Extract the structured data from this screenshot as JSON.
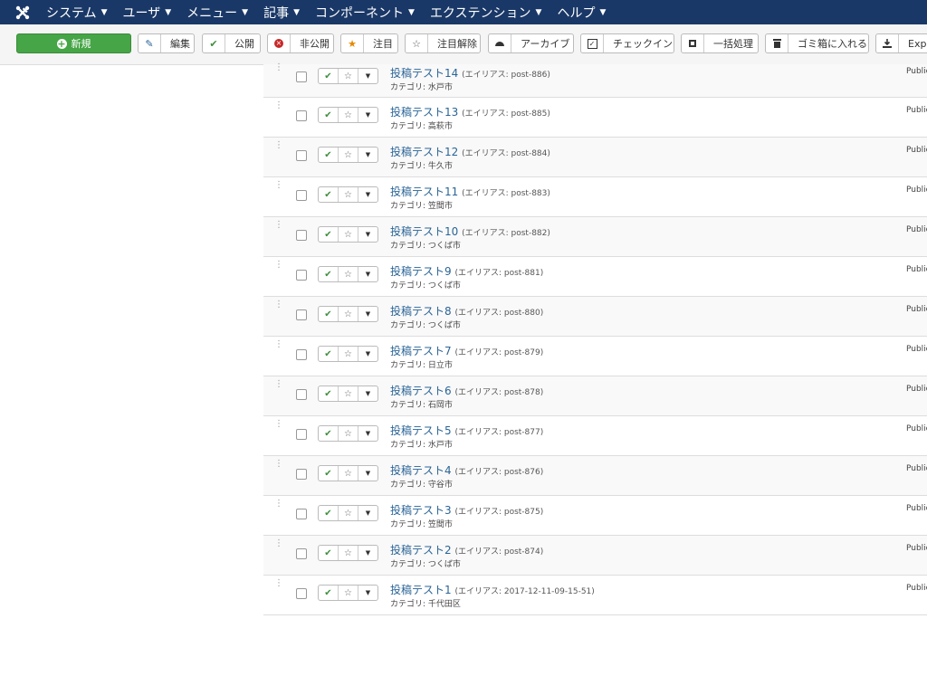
{
  "nav": {
    "items": [
      {
        "label": "システム"
      },
      {
        "label": "ユーザ"
      },
      {
        "label": "メニュー"
      },
      {
        "label": "記事"
      },
      {
        "label": "コンポーネント"
      },
      {
        "label": "エクステンション"
      },
      {
        "label": "ヘルプ"
      }
    ]
  },
  "toolbar": {
    "new_label": "新規",
    "edit_label": "編集",
    "publish_label": "公開",
    "unpublish_label": "非公開",
    "feature_label": "注目",
    "unfeature_label": "注目解除",
    "archive_label": "アーカイブ",
    "checkin_label": "チェックイン",
    "batch_label": "一括処理",
    "trash_label": "ゴミ箱に入れる",
    "export_label": "Expo"
  },
  "articles": {
    "alias_prefix": "(エイリアス: ",
    "alias_suffix": ")",
    "category_prefix": "カテゴリ: ",
    "rows": [
      {
        "title": "投稿テスト14",
        "alias": "post-886",
        "category": "水戸市",
        "status": "Public"
      },
      {
        "title": "投稿テスト13",
        "alias": "post-885",
        "category": "高萩市",
        "status": "Public"
      },
      {
        "title": "投稿テスト12",
        "alias": "post-884",
        "category": "牛久市",
        "status": "Public"
      },
      {
        "title": "投稿テスト11",
        "alias": "post-883",
        "category": "笠間市",
        "status": "Public"
      },
      {
        "title": "投稿テスト10",
        "alias": "post-882",
        "category": "つくば市",
        "status": "Public"
      },
      {
        "title": "投稿テスト9",
        "alias": "post-881",
        "category": "つくば市",
        "status": "Public"
      },
      {
        "title": "投稿テスト8",
        "alias": "post-880",
        "category": "つくば市",
        "status": "Public"
      },
      {
        "title": "投稿テスト7",
        "alias": "post-879",
        "category": "日立市",
        "status": "Public"
      },
      {
        "title": "投稿テスト6",
        "alias": "post-878",
        "category": "石岡市",
        "status": "Public"
      },
      {
        "title": "投稿テスト5",
        "alias": "post-877",
        "category": "水戸市",
        "status": "Public"
      },
      {
        "title": "投稿テスト4",
        "alias": "post-876",
        "category": "守谷市",
        "status": "Public"
      },
      {
        "title": "投稿テスト3",
        "alias": "post-875",
        "category": "笠間市",
        "status": "Public"
      },
      {
        "title": "投稿テスト2",
        "alias": "post-874",
        "category": "つくば市",
        "status": "Public"
      },
      {
        "title": "投稿テスト1",
        "alias": "2017-12-11-09-15-51",
        "category": "千代田区",
        "status": "Public"
      }
    ]
  }
}
